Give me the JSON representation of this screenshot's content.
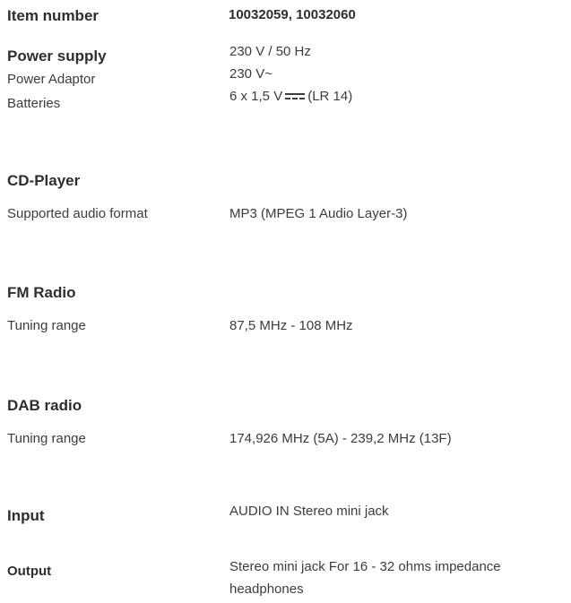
{
  "item": {
    "label": "Item number",
    "value": "10032059, 10032060"
  },
  "power": {
    "heading": "Power supply",
    "value": "230 V / 50 Hz",
    "adaptor_label": "Power Adaptor",
    "adaptor_value": "230 V~",
    "batteries_label": "Batteries",
    "batteries_value_prefix": "6 x 1,5 V",
    "batteries_value_suffix": "(LR 14)"
  },
  "cd": {
    "heading": "CD-Player",
    "format_label": "Supported audio format",
    "format_value": "MP3 (MPEG 1 Audio Layer-3)"
  },
  "fm": {
    "heading": "FM Radio",
    "range_label": "Tuning range",
    "range_value": "87,5 MHz - 108 MHz"
  },
  "dab": {
    "heading": "DAB radio",
    "range_label": "Tuning range",
    "range_value": "174,926 MHz (5A) - 239,2 MHz (13F)"
  },
  "input": {
    "label": "Input",
    "value": "AUDIO IN Stereo mini jack"
  },
  "output": {
    "label": "Output",
    "value_line1": "Stereo mini jack For 16 - 32 ohms impedance",
    "value_line2": "headphones"
  },
  "icons": {
    "dc_symbol": "dc-current-icon"
  }
}
